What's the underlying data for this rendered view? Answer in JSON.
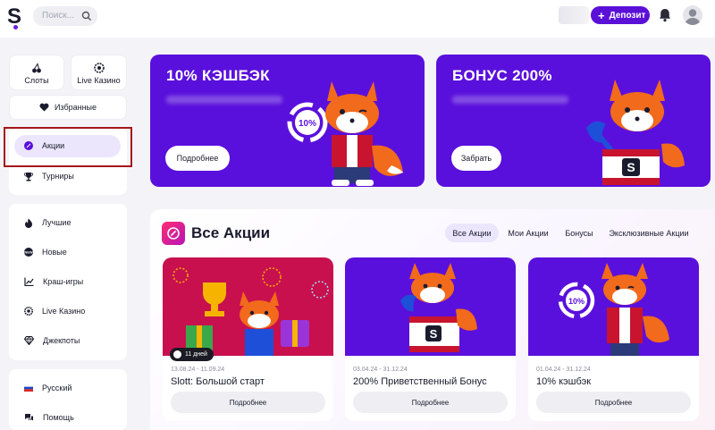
{
  "header": {
    "logo_letter": "S",
    "search_placeholder": "Поиск...",
    "deposit_label": "Депозит",
    "brand_color": "#5b10d8"
  },
  "sidebar": {
    "tiles": [
      {
        "label": "Слоты",
        "icon": "cherries-icon"
      },
      {
        "label": "Live Казино",
        "icon": "roulette-icon"
      }
    ],
    "favorites_label": "Избранные",
    "group1": [
      {
        "label": "Акции",
        "icon": "promo-icon",
        "active": true
      },
      {
        "label": "Турниры",
        "icon": "trophy-icon"
      }
    ],
    "group2": [
      {
        "label": "Лучшие",
        "icon": "fire-icon"
      },
      {
        "label": "Новые",
        "icon": "new-badge-icon"
      },
      {
        "label": "Краш-игры",
        "icon": "chart-icon"
      },
      {
        "label": "Live Казино",
        "icon": "roulette-icon"
      },
      {
        "label": "Джекпоты",
        "icon": "diamond-icon"
      }
    ],
    "group3": [
      {
        "label": "Русский",
        "icon": "russian-flag-icon"
      },
      {
        "label": "Помощь",
        "icon": "chat-icon"
      }
    ]
  },
  "banners": [
    {
      "title": "10% КЭШБЭК",
      "button": "Подробнее"
    },
    {
      "title": "БОНУС 200%",
      "button": "Забрать"
    }
  ],
  "promotions": {
    "title": "Все Акции",
    "tabs": [
      {
        "label": "Все Акции",
        "active": true
      },
      {
        "label": "Мои Акции",
        "active": false
      },
      {
        "label": "Бонусы",
        "active": false
      },
      {
        "label": "Эксклюзивные Акции",
        "active": false
      }
    ],
    "cards": [
      {
        "badge": "11 дней",
        "date": "13.08.24 - 11.09.24",
        "title": "Slott: Большой старт",
        "button": "Подробнее"
      },
      {
        "date": "03.04.24 - 31.12.24",
        "title": "200% Приветственный Бонус",
        "button": "Подробнее"
      },
      {
        "date": "01.04.24 - 31.12.24",
        "title": "10% кэшбэк",
        "button": "Подробнее"
      }
    ]
  },
  "cashback_badge_text": "10%",
  "gift_letter": "S"
}
